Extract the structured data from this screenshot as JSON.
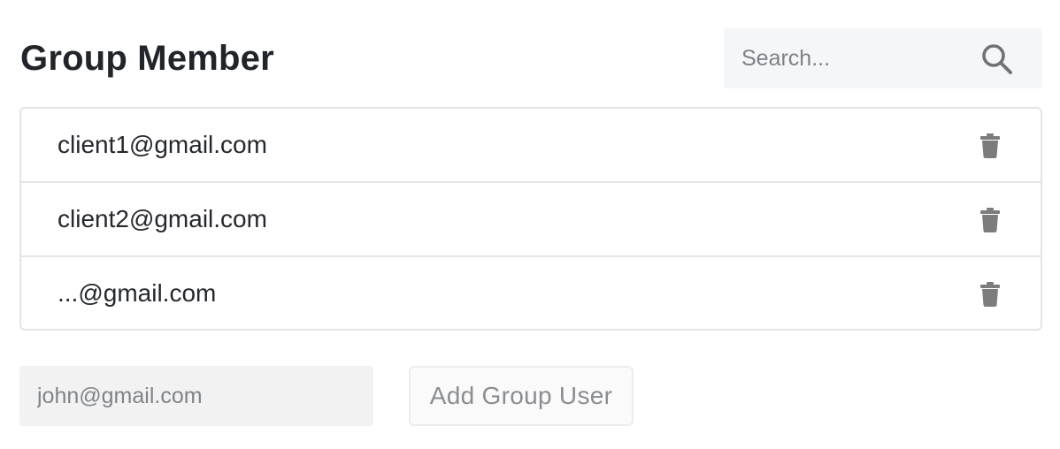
{
  "header": {
    "title": "Group Member"
  },
  "search": {
    "placeholder": "Search...",
    "value": "",
    "icon": "search-icon"
  },
  "members": [
    {
      "email": "client1@gmail.com",
      "action_icon": "trash-icon"
    },
    {
      "email": "client2@gmail.com",
      "action_icon": "trash-icon"
    },
    {
      "email": "...@gmail.com",
      "action_icon": "trash-icon"
    }
  ],
  "add_user": {
    "input_placeholder": "john@gmail.com",
    "input_value": "",
    "button_label": "Add Group User"
  },
  "colors": {
    "text": "#212529",
    "muted": "#7d8187",
    "icon": "#808080",
    "border": "#e3e4e6",
    "input_bg": "#f2f2f2",
    "search_bg": "#f5f6f7"
  }
}
